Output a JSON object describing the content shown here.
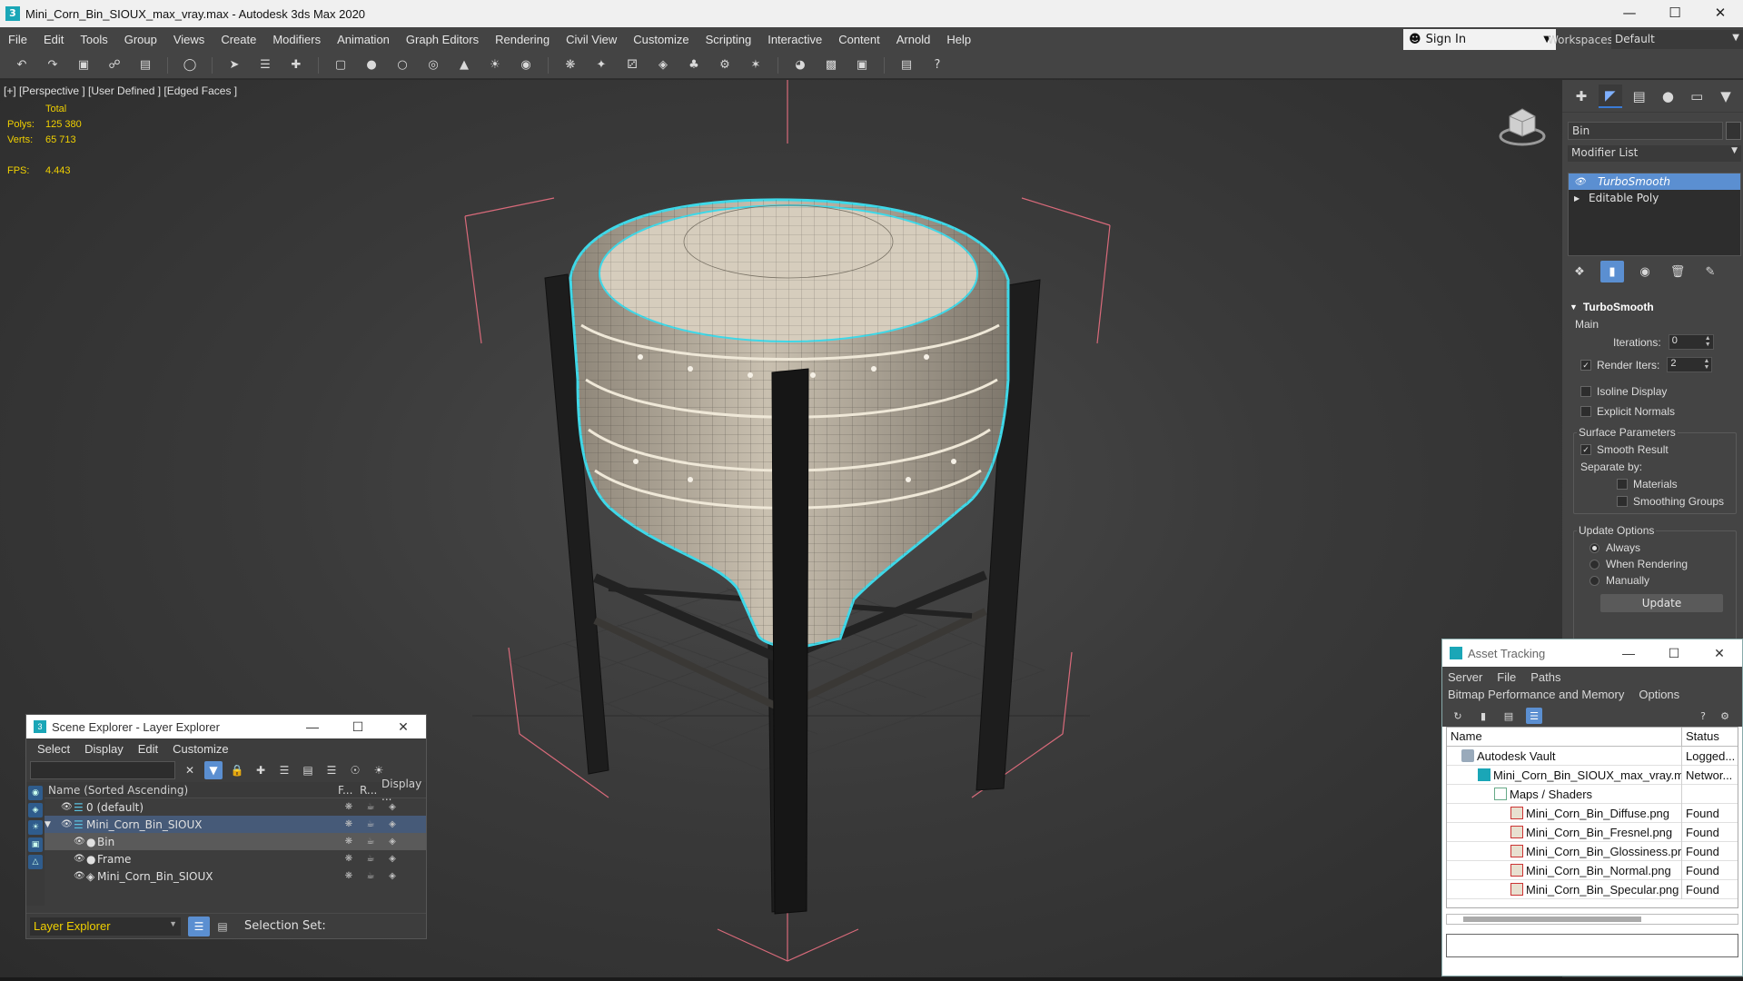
{
  "window": {
    "title": "Mini_Corn_Bin_SIOUX_max_vray.max - Autodesk 3ds Max 2020",
    "minimize": "—",
    "maximize": "☐",
    "close": "✕"
  },
  "menu": {
    "items": [
      "File",
      "Edit",
      "Tools",
      "Group",
      "Views",
      "Create",
      "Modifiers",
      "Animation",
      "Graph Editors",
      "Rendering",
      "Civil View",
      "Customize",
      "Scripting",
      "Interactive",
      "Content",
      "Arnold",
      "Help"
    ],
    "sign_in": "Sign In",
    "workspaces_label": "Workspaces:",
    "workspace_value": "Default"
  },
  "viewport": {
    "label": "[+] [Perspective ] [User Defined ] [Edged Faces ]",
    "stats_header": "Total",
    "polys_label": "Polys:",
    "polys_value": "125 380",
    "verts_label": "Verts:",
    "verts_value": "65 713",
    "fps_label": "FPS:",
    "fps_value": "4.443"
  },
  "scene_explorer": {
    "title": "Scene Explorer - Layer Explorer",
    "menu": [
      "Select",
      "Display",
      "Edit",
      "Customize"
    ],
    "columns": [
      "Name (Sorted Ascending)",
      "F...",
      "R...",
      "Display ..."
    ],
    "rows": [
      {
        "name": "0 (default)",
        "indent": 0
      },
      {
        "name": "Mini_Corn_Bin_SIOUX",
        "indent": 0
      },
      {
        "name": "Bin",
        "indent": 1
      },
      {
        "name": "Frame",
        "indent": 1
      },
      {
        "name": "Mini_Corn_Bin_SIOUX",
        "indent": 1
      }
    ],
    "explorer_dropdown": "Layer Explorer",
    "selection_set_label": "Selection Set:"
  },
  "command_panel": {
    "object_name": "Bin",
    "modifier_list_label": "Modifier List",
    "stack": [
      {
        "label": "TurboSmooth",
        "active": true
      },
      {
        "label": "Editable Poly",
        "active": false
      }
    ],
    "rollout_title": "TurboSmooth",
    "main_label": "Main",
    "iterations_label": "Iterations:",
    "iterations_value": "0",
    "render_iters_label": "Render Iters:",
    "render_iters_value": "2",
    "render_iters_checked": true,
    "isoline_label": "Isoline Display",
    "explicit_normals_label": "Explicit Normals",
    "surface_params_label": "Surface Parameters",
    "smooth_result_label": "Smooth Result",
    "separate_by_label": "Separate by:",
    "materials_label": "Materials",
    "smoothing_groups_label": "Smoothing Groups",
    "update_options_label": "Update Options",
    "always_label": "Always",
    "when_rendering_label": "When Rendering",
    "manually_label": "Manually",
    "update_button": "Update"
  },
  "asset_tracking": {
    "title": "Asset Tracking",
    "menu": [
      "Server",
      "File",
      "Paths",
      "Bitmap Performance and Memory",
      "Options"
    ],
    "columns": [
      "Name",
      "Status"
    ],
    "rows": [
      {
        "name": "Autodesk Vault",
        "status": "Logged...",
        "icon": "vault-icon",
        "indent": 1
      },
      {
        "name": "Mini_Corn_Bin_SIOUX_max_vray.max",
        "status": "Networ...",
        "icon": "max-file-icon",
        "indent": 2
      },
      {
        "name": "Maps / Shaders",
        "status": "",
        "icon": "folder-icon",
        "indent": 3
      },
      {
        "name": "Mini_Corn_Bin_Diffuse.png",
        "status": "Found",
        "icon": "image-file-icon",
        "indent": 4
      },
      {
        "name": "Mini_Corn_Bin_Fresnel.png",
        "status": "Found",
        "icon": "image-file-icon",
        "indent": 4
      },
      {
        "name": "Mini_Corn_Bin_Glossiness.png",
        "status": "Found",
        "icon": "image-file-icon",
        "indent": 4
      },
      {
        "name": "Mini_Corn_Bin_Normal.png",
        "status": "Found",
        "icon": "image-file-icon",
        "indent": 4
      },
      {
        "name": "Mini_Corn_Bin_Specular.png",
        "status": "Found",
        "icon": "image-file-icon",
        "indent": 4
      }
    ]
  },
  "colors": {
    "selection_outline": "#3fd8e8",
    "stats_text": "#f0d000",
    "accent": "#5b8fd1",
    "bbox_lines": "#d86a7a"
  }
}
